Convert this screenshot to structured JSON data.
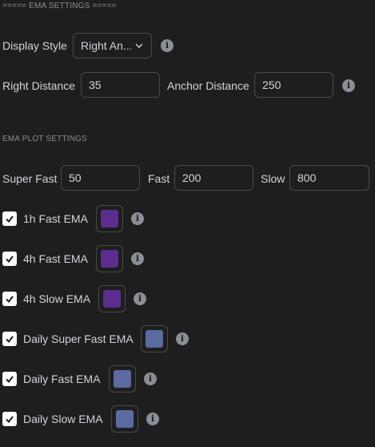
{
  "ema_settings": {
    "header": "===== EMA SETTINGS =====",
    "display_style": {
      "label": "Display Style",
      "value": "Right An..."
    },
    "right_distance": {
      "label": "Right Distance",
      "value": "35"
    },
    "anchor_distance": {
      "label": "Anchor Distance",
      "value": "250"
    },
    "info_icon": "info-icon"
  },
  "plot_settings": {
    "header": "EMA PLOT SETTINGS",
    "super_fast": {
      "label": "Super Fast",
      "value": "50"
    },
    "fast": {
      "label": "Fast",
      "value": "200"
    },
    "slow": {
      "label": "Slow",
      "value": "800"
    },
    "items": [
      {
        "label": "1h Fast EMA",
        "checked": true,
        "color": "#5b2d8e"
      },
      {
        "label": "4h Fast EMA",
        "checked": true,
        "color": "#5b2d8e"
      },
      {
        "label": "4h Slow EMA",
        "checked": true,
        "color": "#5b2d8e"
      },
      {
        "label": "Daily Super Fast EMA",
        "checked": true,
        "color": "#5b6aa0"
      },
      {
        "label": "Daily Fast EMA",
        "checked": true,
        "color": "#5b6aa0"
      },
      {
        "label": "Daily Slow EMA",
        "checked": true,
        "color": "#5b6aa0"
      }
    ]
  },
  "theme": {
    "background": "#1e1e1e",
    "text": "#d1d4dc",
    "border": "#4a4a4a",
    "checkbox": "#ffffff"
  }
}
